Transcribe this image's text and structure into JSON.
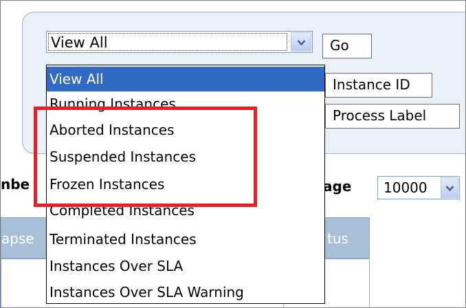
{
  "filter": {
    "select_value": "View All",
    "go_label": "Go",
    "instance_id_label": "Instance ID",
    "process_label_label": "Process Label"
  },
  "dropdown": {
    "options": [
      "View All",
      "Running Instances",
      "Aborted Instances",
      "Suspended Instances",
      "Frozen Instances",
      "Completed Instances",
      "Terminated Instances",
      "Instances Over SLA",
      "Instances Over SLA Warning"
    ],
    "selected_index": 0
  },
  "list_controls": {
    "left_label_fragment": "nbe",
    "right_label_fragment": "age",
    "page_size_value": "10000"
  },
  "table": {
    "header_left_fragment": "apse",
    "header_right_fragment": "tus"
  },
  "colors": {
    "highlight": "#ee1c24",
    "selected_option": "#316ac5",
    "panel_background": "#eaf0f8",
    "table_header": "#a9bfd8"
  },
  "icons": {
    "select_arrow": "chevron-down-icon",
    "page_size_arrow": "chevron-down-icon"
  }
}
